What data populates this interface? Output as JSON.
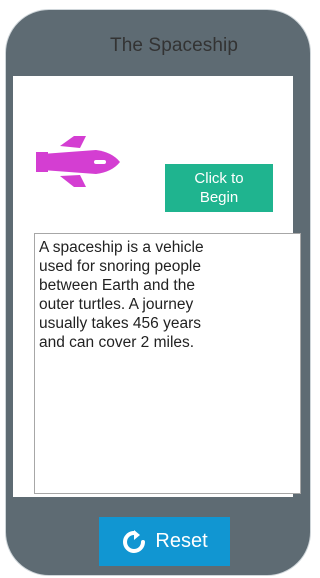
{
  "app": {
    "title": "The Spaceship"
  },
  "actions": {
    "begin_label": "Click to\nBegin",
    "reset_label": "Reset"
  },
  "content": {
    "passage": "A spaceship is a vehicle\nused for snoring people\nbetween Earth and the\nouter turtles. A journey\nusually takes 456 years\nand can cover 2 miles."
  },
  "icons": {
    "ship": "spaceship-icon",
    "reset": "refresh-icon"
  },
  "colors": {
    "frame": "#5e6b73",
    "begin_button": "#1fb48f",
    "reset_button": "#1196d2",
    "ship": "#d43ed2"
  }
}
